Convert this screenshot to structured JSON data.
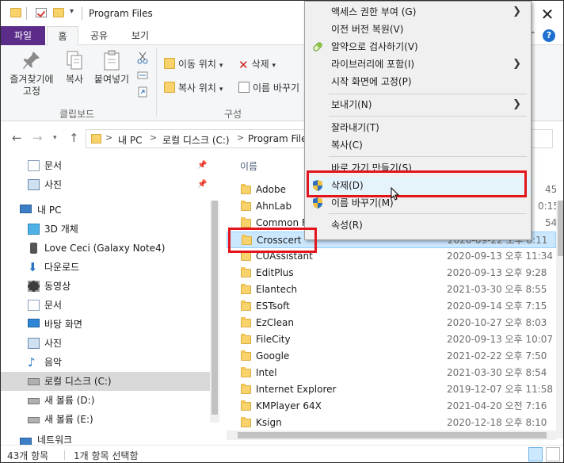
{
  "title_bar": {
    "title": "Program Files",
    "close_glyph": "✕",
    "icons": [
      "folder-icon",
      "properties-check-icon",
      "folder-icon",
      "quick-access-dropdown-icon"
    ]
  },
  "ribbon_tabs": [
    "파일",
    "홈",
    "공유",
    "보기"
  ],
  "ribbon": {
    "pin_label_line1": "즐겨찾기에",
    "pin_label_line2": "고정",
    "copy_label": "복사",
    "paste_label": "붙여넣기",
    "clipboard_group": "클립보드",
    "move_to_label": "이동 위치",
    "copy_to_label": "복사 위치",
    "delete_label": "삭제",
    "rename_label": "이름 바꾸기",
    "organize_group": "구성"
  },
  "address_bar": {
    "parts": [
      "내 PC",
      "로컬 디스크 (C:)",
      "Program Files"
    ],
    "separator": ">"
  },
  "nav_pane": {
    "items": [
      {
        "label": "문서",
        "icon": "documents-icon",
        "pinned": true
      },
      {
        "label": "사진",
        "icon": "pictures-icon",
        "pinned": true
      },
      {
        "label": "내 PC",
        "icon": "this-pc-icon"
      },
      {
        "label": "3D 개체",
        "icon": "3d-objects-icon"
      },
      {
        "label": "Love Ceci (Galaxy Note4)",
        "icon": "phone-icon"
      },
      {
        "label": "다운로드",
        "icon": "downloads-icon"
      },
      {
        "label": "동영상",
        "icon": "videos-icon"
      },
      {
        "label": "문서",
        "icon": "documents-icon"
      },
      {
        "label": "바탕 화면",
        "icon": "desktop-icon"
      },
      {
        "label": "사진",
        "icon": "pictures-icon"
      },
      {
        "label": "음악",
        "icon": "music-icon"
      },
      {
        "label": "로컬 디스크 (C:)",
        "icon": "local-disk-icon",
        "selected": true
      },
      {
        "label": "새 볼륨 (D:)",
        "icon": "drive-icon"
      },
      {
        "label": "새 볼륨 (E:)",
        "icon": "drive-icon"
      },
      {
        "label": "네트워크",
        "icon": "network-icon"
      }
    ]
  },
  "file_list": {
    "column_name": "이름",
    "rows": [
      {
        "name": "Adobe",
        "date": "45"
      },
      {
        "name": "AhnLab",
        "date": "0:15"
      },
      {
        "name": "Common F",
        "date": "54"
      },
      {
        "name": "Crosscert",
        "date": "2020-09-22 오후 8:11",
        "selected": true
      },
      {
        "name": "CUAssistant",
        "date": "2020-09-13 오후 11:34"
      },
      {
        "name": "EditPlus",
        "date": "2020-09-13 오후 9:28"
      },
      {
        "name": "Elantech",
        "date": "2021-03-30 오후 8:55"
      },
      {
        "name": "ESTsoft",
        "date": "2020-09-14 오후 7:15"
      },
      {
        "name": "EzClean",
        "date": "2020-10-27 오후 8:03"
      },
      {
        "name": "FileCity",
        "date": "2020-09-13 오후 10:07"
      },
      {
        "name": "Google",
        "date": "2021-02-22 오후 7:50"
      },
      {
        "name": "Intel",
        "date": "2021-03-30 오후 8:54"
      },
      {
        "name": "Internet Explorer",
        "date": "2019-12-07 오후 11:58"
      },
      {
        "name": "KMPlayer 64X",
        "date": "2021-04-20 오전 7:16"
      },
      {
        "name": "Ksign",
        "date": "2020-12-18 오후 8:10"
      }
    ]
  },
  "status_bar": {
    "item_count": "43개 항목",
    "selected_count": "1개 항목 선택함"
  },
  "context_menu": {
    "items": [
      {
        "label": "액세스 권한 부여 (G)",
        "submenu": true
      },
      {
        "label": "이전 버전 복원(V)"
      },
      {
        "label": "알약으로 검사하기(V)",
        "icon": "alyac-scan-icon"
      },
      {
        "label": "라이브러리에 포함(I)",
        "submenu": true
      },
      {
        "label": "시작 화면에 고정(P)"
      },
      {
        "label": "보내기(N)",
        "submenu": true
      },
      {
        "label": "잘라내기(T)"
      },
      {
        "label": "복사(C)"
      },
      {
        "label": "바로 가기 만들기(S)"
      },
      {
        "label": "삭제(D)",
        "icon": "uac-shield-icon",
        "highlighted": true
      },
      {
        "label": "이름 바꾸기(M)",
        "icon": "uac-shield-icon"
      },
      {
        "label": "속성(R)"
      }
    ],
    "submenu_arrow": "❯"
  },
  "colors": {
    "file_tab": "#5b2c8a",
    "highlight_box": "#e3151c",
    "selection_bg": "#cce8ff",
    "folder": "#f8d36b"
  }
}
